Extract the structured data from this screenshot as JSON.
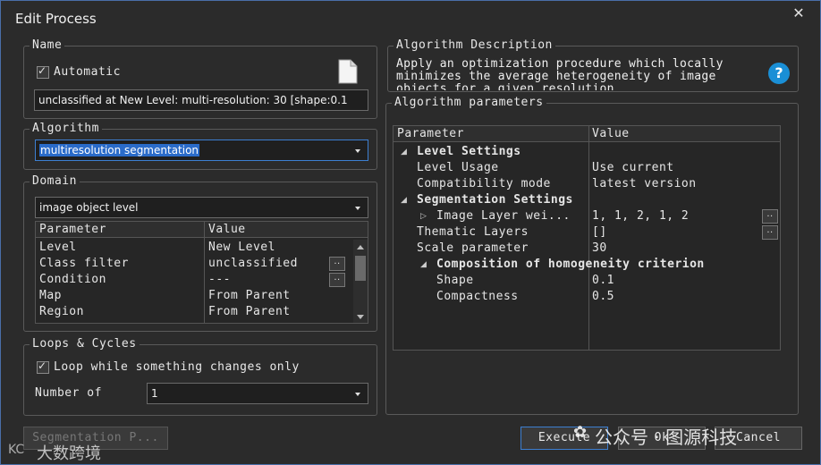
{
  "window": {
    "title": "Edit Process",
    "close": "✕"
  },
  "name_group": {
    "legend": "Name",
    "automatic_label": "Automatic",
    "name_value": "unclassified at New Level: multi-resolution: 30 [shape:0.1"
  },
  "algorithm_group": {
    "legend": "Algorithm",
    "value": "multiresolution segmentation"
  },
  "domain_group": {
    "legend": "Domain",
    "value": "image object level",
    "table_headers": {
      "param": "Parameter",
      "value": "Value"
    },
    "rows": [
      {
        "param": "Level",
        "value": "New Level"
      },
      {
        "param": "Class filter",
        "value": "unclassified"
      },
      {
        "param": "Condition",
        "value": "---"
      },
      {
        "param": "Map",
        "value": "From Parent"
      },
      {
        "param": "Region",
        "value": "From Parent"
      }
    ]
  },
  "loops_group": {
    "legend": "Loops & Cycles",
    "loop_label": "Loop while something changes only",
    "number_label": "Number of",
    "number_value": "1"
  },
  "description_group": {
    "legend": "Algorithm Description",
    "line1": "Apply an optimization procedure which locally",
    "line2": "minimizes the average heterogeneity of image",
    "line3": "objects for a given resolution",
    "help": "?"
  },
  "params_group": {
    "legend": "Algorithm parameters",
    "headers": {
      "param": "Parameter",
      "value": "Value"
    },
    "level_settings": "Level Settings",
    "level_usage": {
      "param": "Level Usage",
      "value": "Use current"
    },
    "compat_mode": {
      "param": "Compatibility mode",
      "value": "latest version"
    },
    "segmentation_settings": "Segmentation Settings",
    "image_layer": {
      "param": "Image Layer wei...",
      "value": "1, 1, 2, 1, 2"
    },
    "thematic_layers": {
      "param": "Thematic Layers",
      "value": "[]"
    },
    "scale_parameter": {
      "param": "Scale parameter",
      "value": "30"
    },
    "composition": "Composition of homogeneity criterion",
    "shape": {
      "param": "Shape",
      "value": "0.1"
    },
    "compactness": {
      "param": "Compactness",
      "value": "0.5"
    }
  },
  "buttons": {
    "segmentation": "Segmentation P...",
    "execute": "Execute",
    "ok": "Ok",
    "cancel": "Cancel",
    "dots": ".."
  },
  "watermark": {
    "right": "公众号 · 图源科技",
    "left": "大数跨境"
  }
}
